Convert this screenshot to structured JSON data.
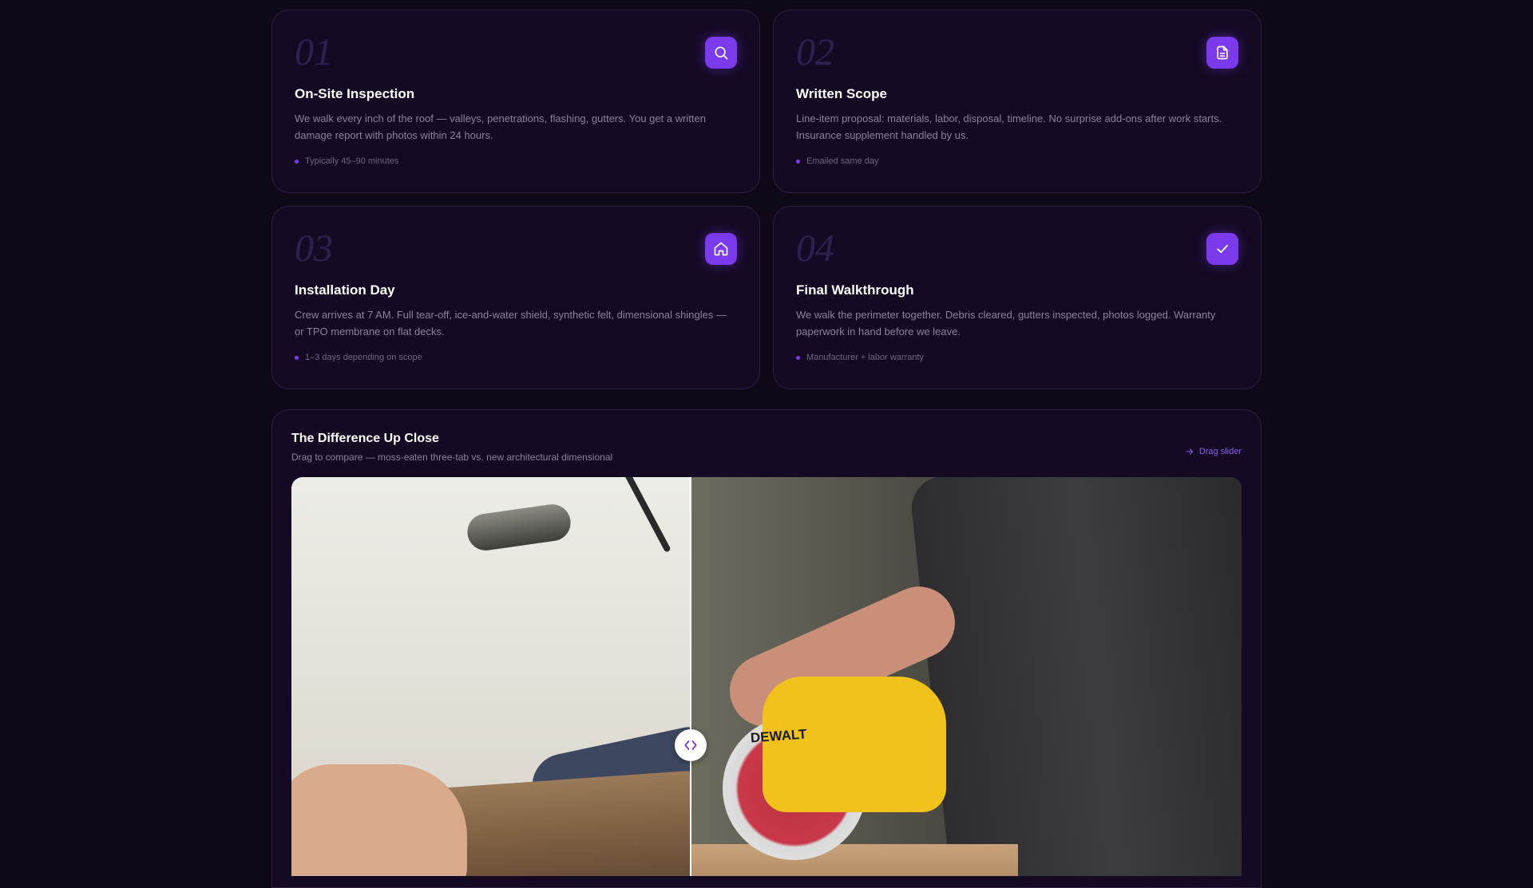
{
  "steps": [
    {
      "number": "01",
      "title": "On-Site Inspection",
      "description": "We walk every inch of the roof — valleys, penetrations, flashing, gutters. You get a written damage report with photos within 24 hours.",
      "meta": "Typically 45–90 minutes",
      "icon": "search-icon"
    },
    {
      "number": "02",
      "title": "Written Scope",
      "description": "Line-item proposal: materials, labor, disposal, timeline. No surprise add-ons after work starts. Insurance supplement handled by us.",
      "meta": "Emailed same day",
      "icon": "document-icon"
    },
    {
      "number": "03",
      "title": "Installation Day",
      "description": "Crew arrives at 7 AM. Full tear-off, ice-and-water shield, synthetic felt, dimensional shingles — or TPO membrane on flat decks.",
      "meta": "1–3 days depending on scope",
      "icon": "home-icon"
    },
    {
      "number": "04",
      "title": "Final Walkthrough",
      "description": "We walk the perimeter together. Debris cleared, gutters inspected, photos logged. Warranty paperwork in hand before we leave.",
      "meta": "Manufacturer + labor warranty",
      "icon": "check-icon"
    }
  ],
  "compare": {
    "title": "The Difference Up Close",
    "subtitle": "Drag to compare — moss-eaten three-tab vs. new architectural dimensional",
    "drag_label": "Drag slider",
    "photo_brand_text": "DEWALT",
    "slider_position": 0.42
  },
  "colors": {
    "background": "#0f0818",
    "card": "#150a24",
    "accent": "#7c3aed"
  }
}
